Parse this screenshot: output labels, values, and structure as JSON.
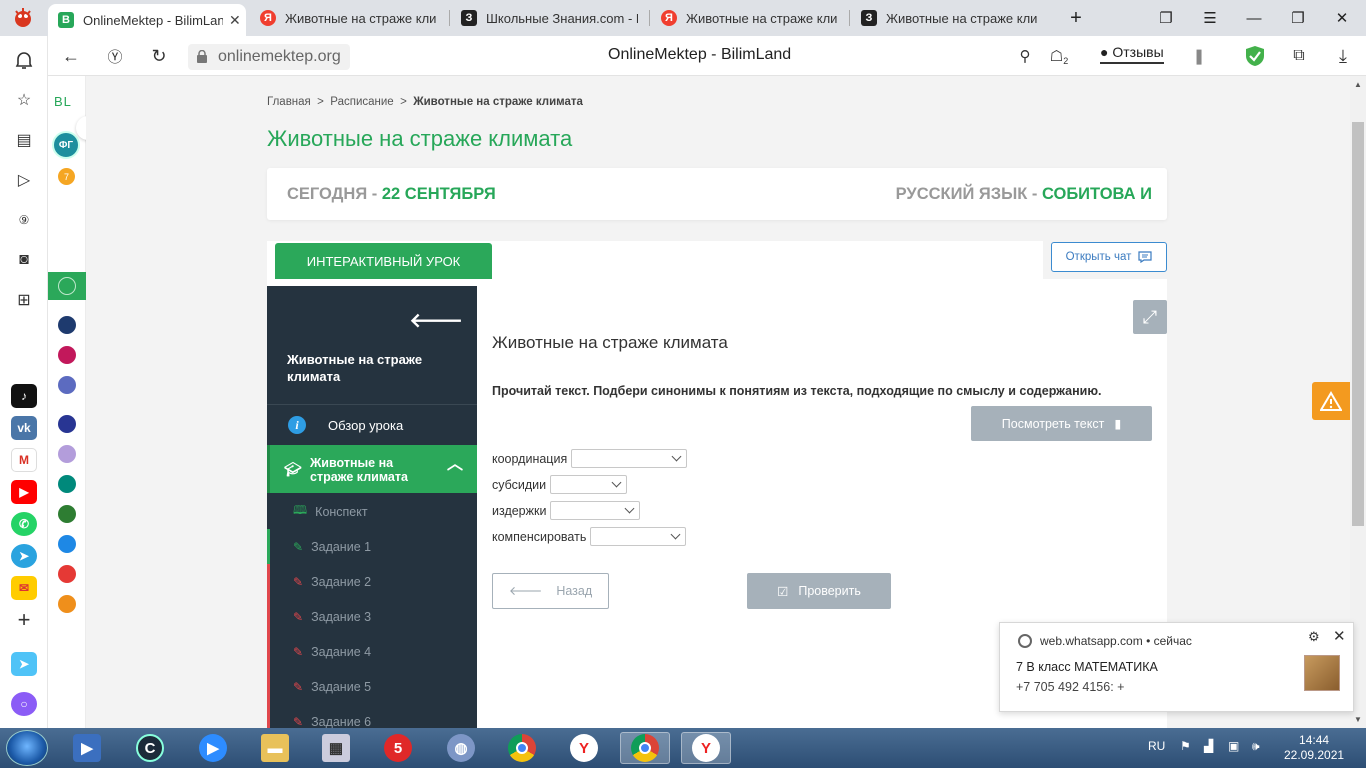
{
  "browser": {
    "tabs": [
      {
        "title": "OnlineMektep - BilimLand",
        "fav": "B",
        "color": "#27a759"
      },
      {
        "title": "Животные на страже клим",
        "fav": "Я",
        "color": "#f03e2f"
      },
      {
        "title": "Школьные Знания.com - Р",
        "fav": "З",
        "color": "#222222"
      },
      {
        "title": "Животные на страже клим",
        "fav": "Я",
        "color": "#f03e2f"
      },
      {
        "title": "Животные на страже клим",
        "fav": "З",
        "color": "#222222"
      }
    ],
    "url": "onlinemektep.org",
    "page_title": "OnlineMektep - BilimLand",
    "reviews": "Отзывы",
    "tab_badge": "2"
  },
  "site": {
    "logo": "BL",
    "avatar": "ФГ",
    "badge": "7"
  },
  "breadcrumb": {
    "home": "Главная",
    "sep": ">",
    "schedule": "Расписание",
    "current": "Животные на страже климата"
  },
  "title": "Животные на страже климата",
  "today": {
    "label": "СЕГОДНЯ - ",
    "date": "22 СЕНТЯБРЯ"
  },
  "subject": {
    "label": "РУССКИЙ ЯЗЫК - ",
    "teacher": "СОБИТОВА И"
  },
  "interactive_tab": "ИНТЕРАКТИВНЫЙ УРОК",
  "chat_button": "Открыть чат",
  "nav": {
    "lesson_title": "Животные на страже климата",
    "overview": "Обзор урока",
    "active_section": "Животные на страже климата",
    "items": [
      "Конспект",
      "Задание 1",
      "Задание 2",
      "Задание 3",
      "Задание 4",
      "Задание 5",
      "Задание 6"
    ]
  },
  "task": {
    "title": "Животные на страже климата",
    "instruction": "Прочитай текст. Подбери синонимы к понятиям из текста, подходящие по смыслу и содержанию.",
    "view_text_button": "Посмотреть текст",
    "fields": [
      "координация",
      "субсидии",
      "издержки",
      "компенсировать"
    ],
    "back_button": "Назад",
    "check_button": "Проверить"
  },
  "notification": {
    "source": "web.whatsapp.com",
    "time": "• сейчас",
    "title": "7 В класс МАТЕМАТИКА",
    "body": "+7 705 492 4156: +"
  },
  "taskbar": {
    "lang": "RU",
    "time": "14:44",
    "date": "22.09.2021"
  },
  "colors": {
    "brand_green": "#27a759",
    "dark_nav": "#25333f",
    "disabled_btn": "#a6b1ba",
    "warn": "#f39a1f"
  }
}
